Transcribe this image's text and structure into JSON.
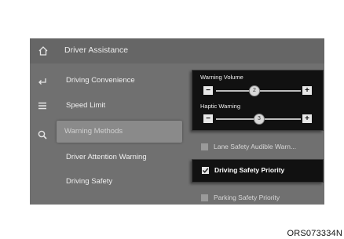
{
  "header": {
    "title": "Driver Assistance"
  },
  "sidebar_icons": [
    "home-icon",
    "back-icon",
    "menu-icon",
    "search-icon"
  ],
  "menu": {
    "items": [
      {
        "label": "Driving Convenience"
      },
      {
        "label": "Speed Limit"
      },
      {
        "label": "Warning Methods",
        "selected": true
      },
      {
        "label": "Driver Attention Warning"
      },
      {
        "label": "Driving Safety"
      }
    ]
  },
  "warning_volume": {
    "label": "Warning Volume",
    "value": "2",
    "minus": "−",
    "plus": "+"
  },
  "haptic_warning": {
    "label": "Haptic Warning",
    "value": "3",
    "minus": "−",
    "plus": "+"
  },
  "options": {
    "lane_safety": {
      "label": "Lane Safety Audible Warn...",
      "checked": false
    },
    "driving_safety_priority": {
      "label": "Driving Safety Priority",
      "checked": true
    },
    "parking_safety_priority": {
      "label": "Parking Safety Priority",
      "checked": false
    }
  },
  "caption": "ORS073334N"
}
